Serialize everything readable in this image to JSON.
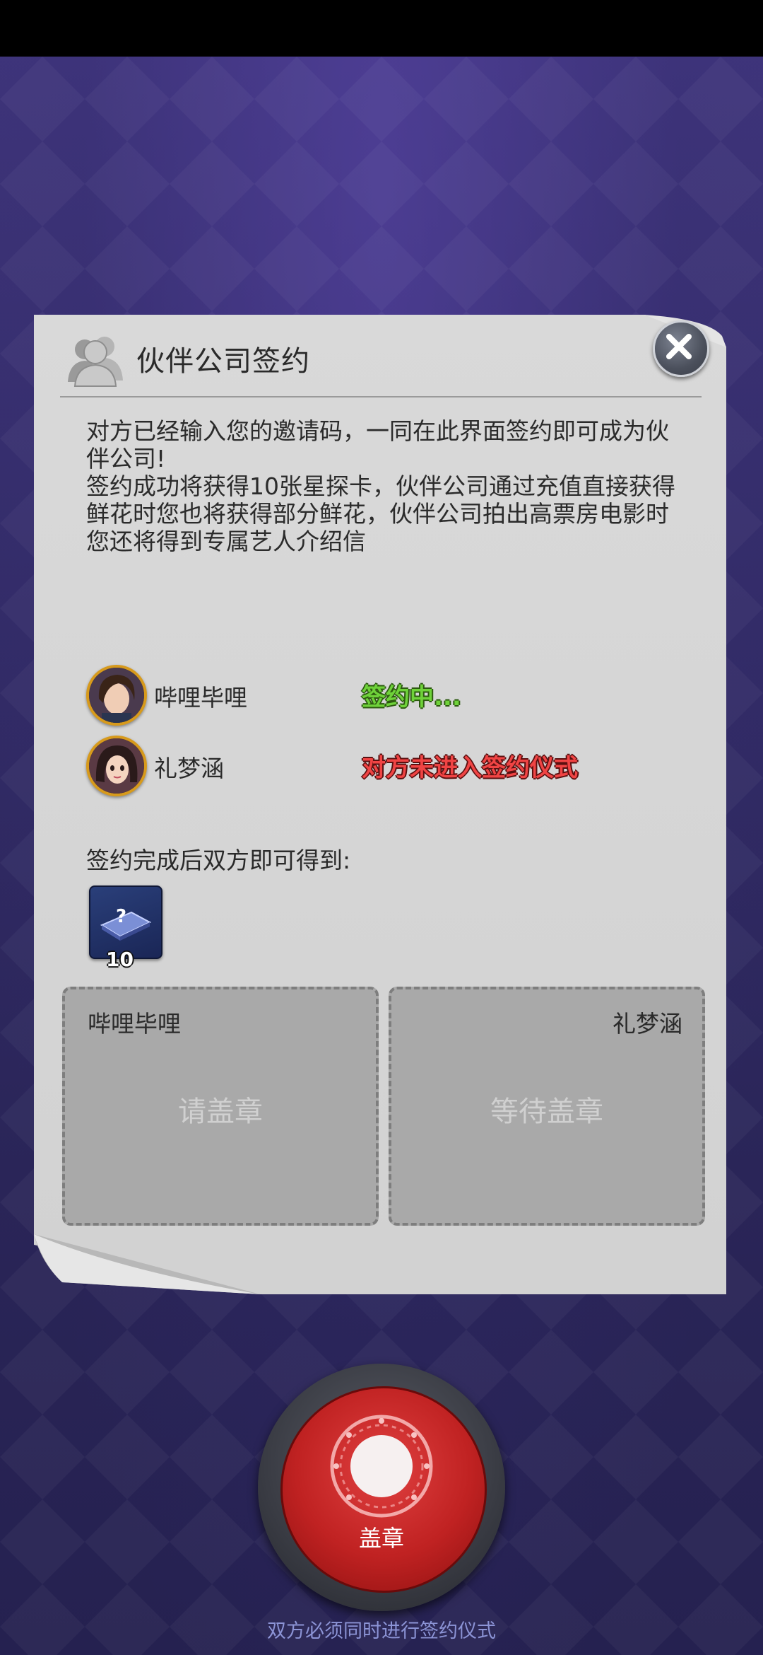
{
  "panel": {
    "title": "伙伴公司签约",
    "description": [
      "对方已经输入您的邀请码，一同在此界面签约即可成为伙伴公司!",
      "签约成功将获得10张星探卡，伙伴公司通过充值直接获得鲜花时您也将获得部分鲜花，伙伴公司拍出高票房电影时您还将得到专属艺人介绍信"
    ]
  },
  "members": [
    {
      "name": "哔哩毕哩",
      "status": "签约中...",
      "status_color": "#6fd23a"
    },
    {
      "name": "礼梦涵",
      "status": "对方未进入签约仪式",
      "status_color": "#f04444"
    }
  ],
  "reward": {
    "label": "签约完成后双方即可得到:",
    "item_icon": "scout-card-icon",
    "count": "10"
  },
  "seal_boxes": {
    "left": {
      "party": "哔哩毕哩",
      "hint": "请盖章"
    },
    "right": {
      "party": "礼梦涵",
      "hint": "等待盖章"
    }
  },
  "stamp_button": {
    "label": "盖章"
  },
  "footer": {
    "note": "双方必须同时进行签约仪式"
  },
  "colors": {
    "background": "#332c68",
    "paper": "#d6d6d6",
    "stamp_red": "#c02222",
    "footer_text": "#8c94d6"
  }
}
